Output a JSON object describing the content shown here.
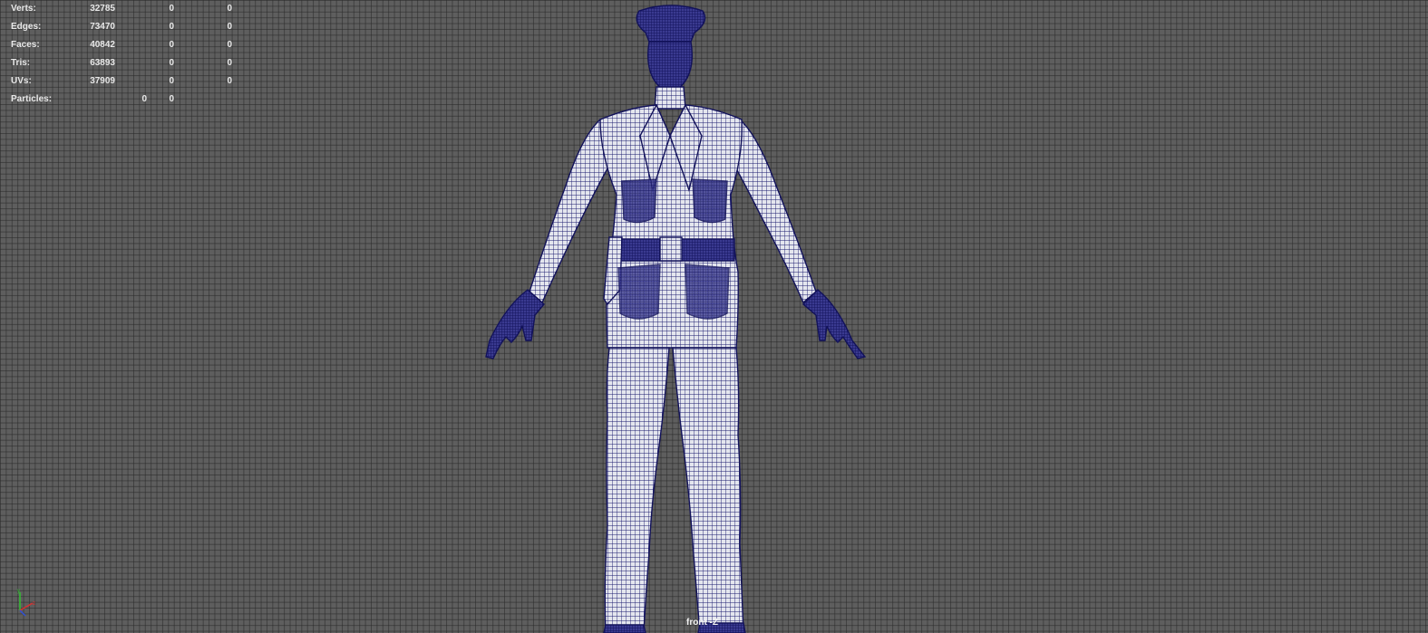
{
  "hud": {
    "rows": [
      {
        "label": "Verts:",
        "c1": "32785",
        "c2": "0",
        "c3": "0"
      },
      {
        "label": "Edges:",
        "c1": "73470",
        "c2": "0",
        "c3": "0"
      },
      {
        "label": "Faces:",
        "c1": "40842",
        "c2": "0",
        "c3": "0"
      },
      {
        "label": "Tris:",
        "c1": "63893",
        "c2": "0",
        "c3": "0"
      },
      {
        "label": "UVs:",
        "c1": "37909",
        "c2": "0",
        "c3": "0"
      }
    ],
    "particles": {
      "label": "Particles:",
      "c1": "0",
      "c2": "0"
    }
  },
  "viewport": {
    "camera_label": "front -Z",
    "background_color": "#5e5e5e",
    "wire_color": "#1a1a6e"
  },
  "axis_indicator": {
    "x_color": "#d83030",
    "y_color": "#30c030"
  },
  "model": {
    "icon": "policeman-wireframe-icon"
  }
}
